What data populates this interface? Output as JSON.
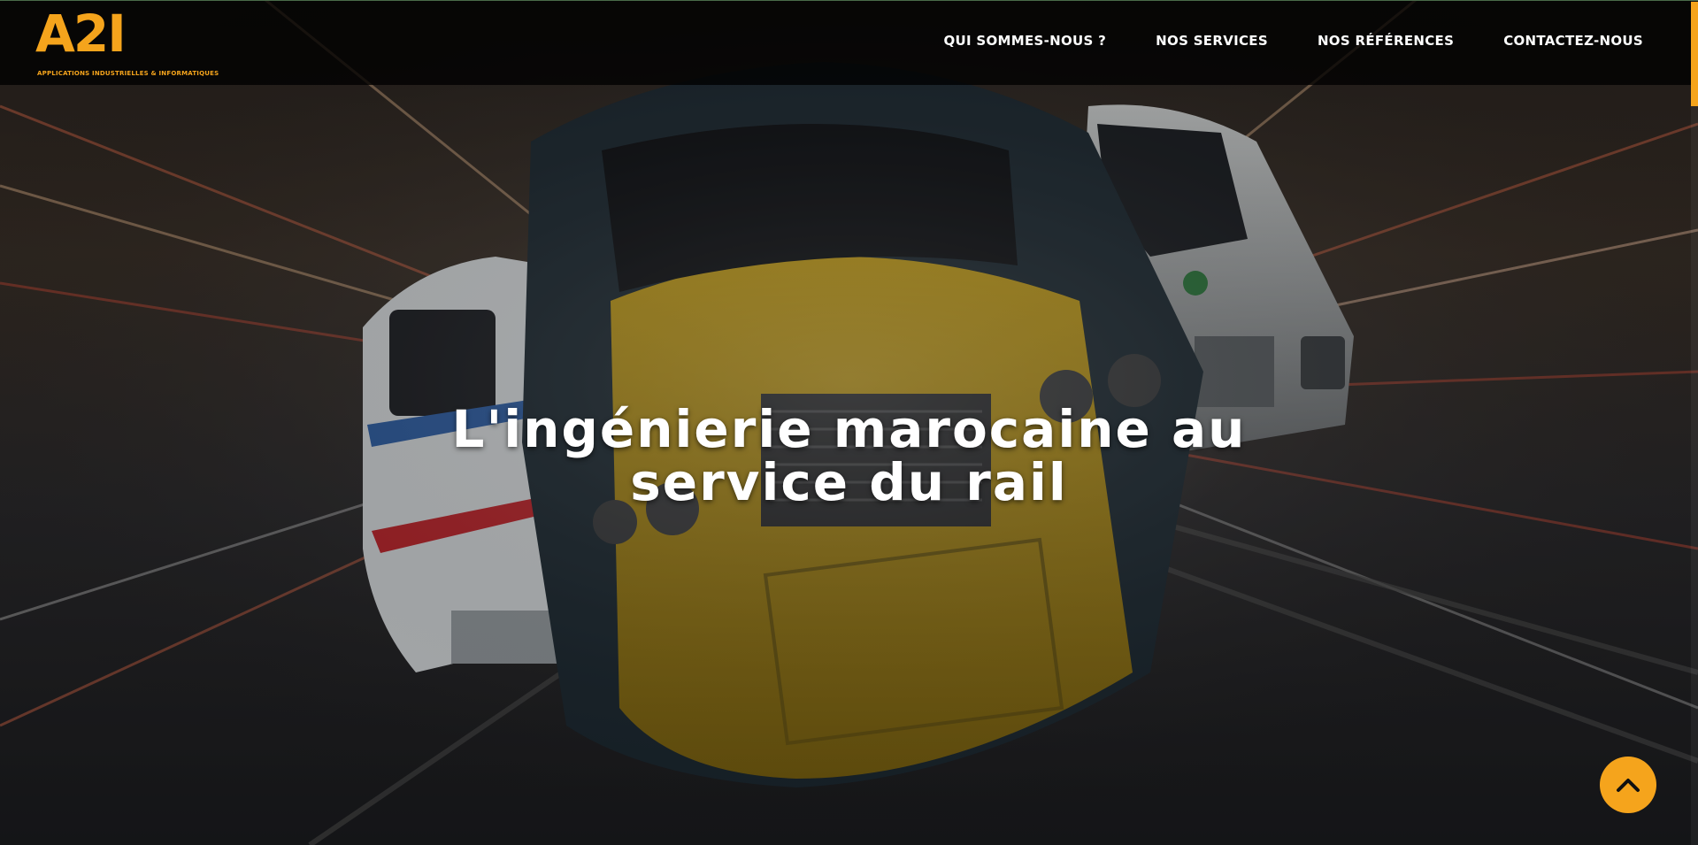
{
  "brand": {
    "logo_text": "A2I",
    "tagline": "Applications industrielles & informatiques",
    "accent_color": "#f5a41c"
  },
  "nav": {
    "items": [
      {
        "label": "Qui sommes-nous ?"
      },
      {
        "label": "Nos services"
      },
      {
        "label": "Nos références"
      },
      {
        "label": "Contactez-nous"
      }
    ]
  },
  "hero": {
    "title_line1": "L'ingénierie marocaine au",
    "title_line2": "service du rail"
  },
  "back_to_top": {
    "icon": "chevron-up-icon"
  }
}
